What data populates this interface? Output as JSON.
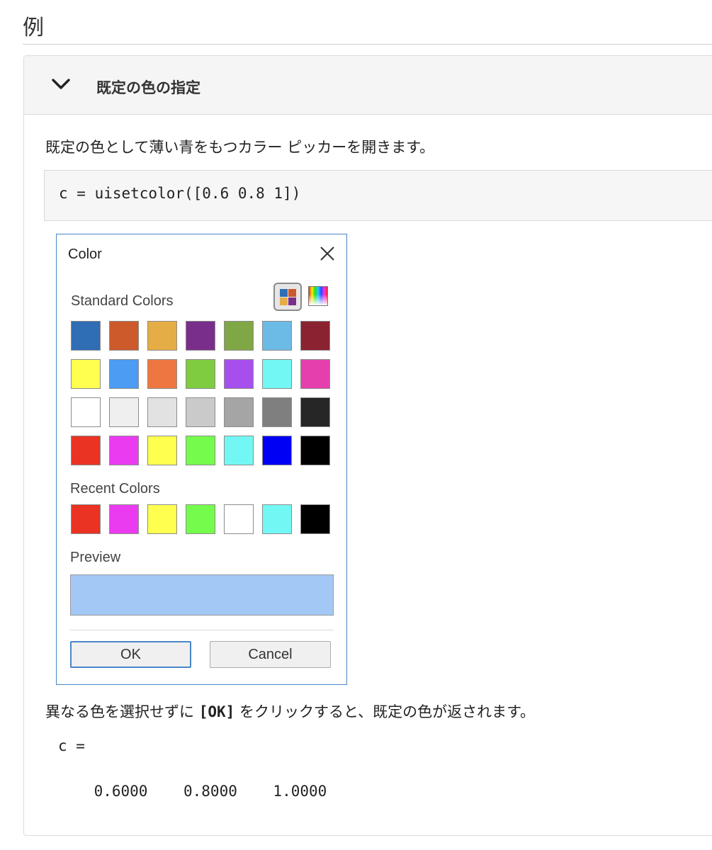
{
  "section": {
    "heading": "例"
  },
  "example": {
    "title": "既定の色の指定",
    "description": "既定の色として薄い青をもつカラー ピッカーを開きます。",
    "code": "c = uisetcolor([0.6 0.8 1])",
    "result_prefix": "異なる色を選択せずに ",
    "result_ok": "[OK]",
    "result_suffix": " をクリックすると、既定の色が返されます。",
    "output_label": "c =",
    "output_value": "    0.6000    0.8000    1.0000"
  },
  "dialog": {
    "title": "Color",
    "close_icon": "close-icon",
    "tabs": [
      "standard-colors-tab-icon",
      "custom-colors-tab-icon"
    ],
    "standard_label": "Standard Colors",
    "standard_colors": [
      [
        "#2f6db5",
        "#cd5a2b",
        "#e5ad45",
        "#7a2e8c",
        "#80a745",
        "#6cbbe6",
        "#8b2232"
      ],
      [
        "#ffff50",
        "#4b9cf2",
        "#ee7640",
        "#7fcc40",
        "#a74fed",
        "#73f7f5",
        "#e53fae"
      ],
      [
        "#ffffff",
        "#efefef",
        "#e2e2e2",
        "#cacaca",
        "#a5a5a5",
        "#7f7f7f",
        "#262626"
      ],
      [
        "#ea3323",
        "#ea3bf1",
        "#ffff50",
        "#75fb4c",
        "#73f7f5",
        "#0000f5",
        "#000000"
      ]
    ],
    "recent_label": "Recent Colors",
    "recent_colors": [
      "#ea3323",
      "#ea3bf1",
      "#ffff50",
      "#75fb4c",
      "#ffffff",
      "#73f7f5",
      "#000000"
    ],
    "preview_label": "Preview",
    "preview_color": "#a3c8f6",
    "ok_label": "OK",
    "cancel_label": "Cancel"
  }
}
